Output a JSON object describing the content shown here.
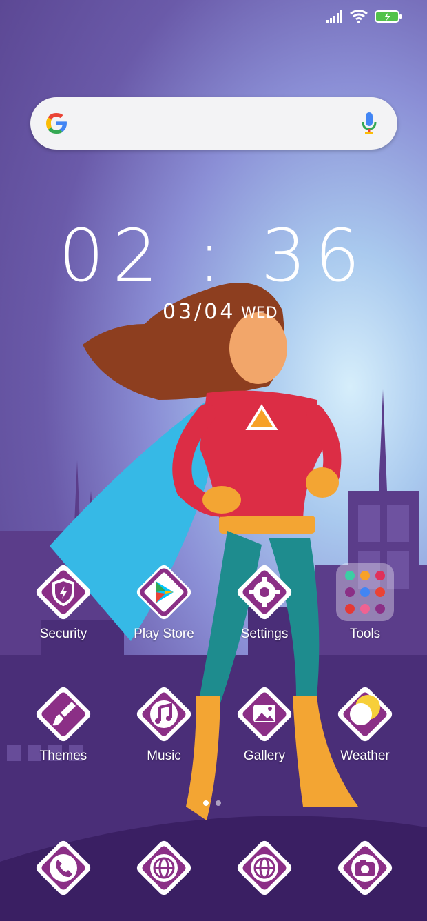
{
  "status_bar": {
    "icons": [
      "signal-icon",
      "wifi-icon",
      "battery-charging-icon"
    ]
  },
  "search": {
    "logo": "google-g-icon",
    "mic": "mic-icon"
  },
  "clock": {
    "time": "02 : 36",
    "date": "03/04",
    "day": "WED"
  },
  "apps": [
    {
      "label": "Security",
      "icon": "shield-icon"
    },
    {
      "label": "Play Store",
      "icon": "play-store-icon"
    },
    {
      "label": "Settings",
      "icon": "gear-icon"
    },
    {
      "label": "Tools",
      "icon": "folder-icon"
    },
    {
      "label": "Themes",
      "icon": "paintbrush-icon"
    },
    {
      "label": "Music",
      "icon": "music-note-icon"
    },
    {
      "label": "Gallery",
      "icon": "image-icon"
    },
    {
      "label": "Weather",
      "icon": "weather-icon"
    }
  ],
  "dock": [
    {
      "icon": "phone-icon"
    },
    {
      "icon": "globe-icon"
    },
    {
      "icon": "globe-icon"
    },
    {
      "icon": "camera-icon"
    }
  ],
  "page_dots": {
    "count": 2,
    "active": 0
  }
}
